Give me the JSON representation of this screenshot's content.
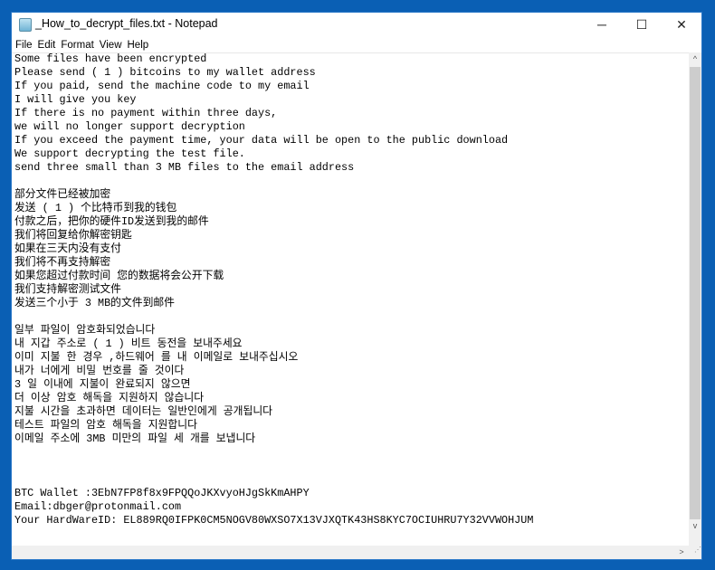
{
  "window": {
    "title": "_How_to_decrypt_files.txt - Notepad",
    "controls": {
      "minimize": "─",
      "maximize": "☐",
      "close": "✕"
    }
  },
  "menu": [
    "File",
    "Edit",
    "Format",
    "View",
    "Help"
  ],
  "document": {
    "lines": [
      "Some files have been encrypted",
      "Please send ( 1 ) bitcoins to my wallet address",
      "If you paid, send the machine code to my email",
      "I will give you key",
      "If there is no payment within three days,",
      "we will no longer support decryption",
      "If you exceed the payment time, your data will be open to the public download",
      "We support decrypting the test file.",
      "send three small than 3 MB files to the email address",
      "",
      "部分文件已经被加密",
      "发送 ( 1 ) 个比特币到我的钱包",
      "付款之后，把你的硬件ID发送到我的邮件",
      "我们将回复给你解密钥匙",
      "如果在三天内没有支付",
      "我们将不再支持解密",
      "如果您超过付款时间 您的数据将会公开下载",
      "我们支持解密测试文件",
      "发送三个小于 3 MB的文件到邮件",
      "",
      "일부 파일이 암호화되었습니다",
      "내 지갑 주소로 ( 1 ) 비트 동전을 보내주세요",
      "이미 지불 한 경우 ,하드웨어 를 내 이메일로 보내주십시오",
      "내가 너에게 비밀 번호를 줄 것이다",
      "3 일 이내에 지불이 완료되지 않으면",
      "더 이상 암호 해독을 지원하지 않습니다",
      "지불 시간을 초과하면 데이터는 일반인에게 공개됩니다",
      "테스트 파일의 암호 해독을 지원합니다",
      "이메일 주소에 3MB 미만의 파일 세 개를 보냅니다",
      "",
      "",
      "",
      "BTC Wallet :3EbN7FP8f8x9FPQQoJKXvyoHJgSkKmAHPY",
      "Email:dbger@protonmail.com",
      "Your HardWareID: EL889RQ0IFPK0CM5NOGV80WXSO7X13VJXQTK43HS8KYC7OCIUHRU7Y32VVWOHJUM"
    ]
  }
}
